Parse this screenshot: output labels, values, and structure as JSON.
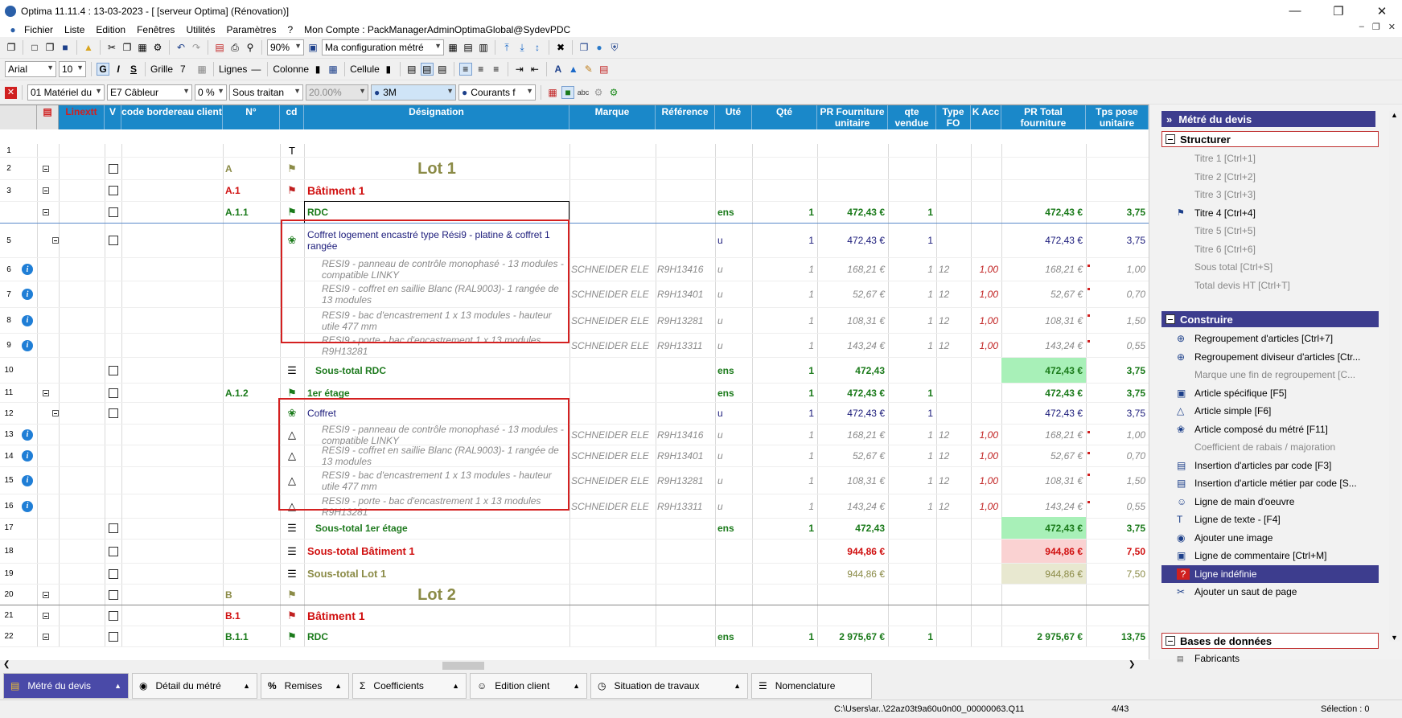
{
  "window": {
    "title": "Optima 11.11.4 : 13-03-2023 - [ [serveur Optima] (Rénovation)]"
  },
  "menu": [
    "Fichier",
    "Liste",
    "Edition",
    "Fenêtres",
    "Utilités",
    "Paramètres",
    "?",
    "Mon Compte : PackManagerAdminOptimaGlobal@SydevPDC"
  ],
  "toolbar1": {
    "zoom": "90%",
    "config": "Ma configuration métré"
  },
  "toolbar2": {
    "font": "Arial",
    "size": "10",
    "bold": "G",
    "italic": "I",
    "strike": "S",
    "grille": "Grille",
    "grille_val": "7",
    "lignes": "Lignes",
    "colonne": "Colonne",
    "cellule": "Cellule"
  },
  "toolbar3": {
    "materiel": "01  Matériel du",
    "cableur": "E7  Câbleur",
    "pct": "0 %",
    "sous_traitance": "Sous traitan",
    "taux": "20.00%",
    "fabricant": "3M",
    "courants": "Courants f"
  },
  "columns": {
    "linextt": "Linextt",
    "v": "V",
    "code": "code bordereau client",
    "n": "N°",
    "cd": "cd",
    "designation": "Désignation",
    "marque": "Marque",
    "reference": "Référence",
    "ute": "Uté",
    "qte": "Qté",
    "pr_fourn": "PR Fourniture unitaire",
    "qte_vendue": "qte vendue",
    "type_fo": "Type FO",
    "k_acc": "K Acc",
    "pr_total": "PR Total fourniture",
    "tps_pose": "Tps pose unitaire"
  },
  "rows": [
    {
      "n": "1",
      "code": "",
      "des": "",
      "ute": "",
      "qte": "",
      "pu": "",
      "qv": "",
      "fo": "",
      "k": "",
      "tot": "",
      "tps": ""
    },
    {
      "n": "2",
      "code": "A",
      "des": "Lot 1",
      "ute": "",
      "qte": "",
      "pu": "",
      "qv": "",
      "fo": "",
      "k": "",
      "tot": "",
      "tps": ""
    },
    {
      "n": "3",
      "code": "A.1",
      "des": "Bâtiment 1",
      "ute": "",
      "qte": "",
      "pu": "",
      "qv": "",
      "fo": "",
      "k": "",
      "tot": "",
      "tps": ""
    },
    {
      "n": "",
      "code": "A.1.1",
      "des": "RDC",
      "ute": "ens",
      "qte": "1",
      "pu": "472,43 €",
      "qv": "1",
      "fo": "",
      "k": "",
      "tot": "472,43 €",
      "tps": "3,75"
    },
    {
      "n": "5",
      "code": "",
      "des": "Coffret logement encastré type Rési9 - platine & coffret 1 rangée",
      "ute": "u",
      "qte": "1",
      "pu": "472,43 €",
      "qv": "1",
      "fo": "",
      "k": "",
      "tot": "472,43 €",
      "tps": "3,75"
    },
    {
      "n": "6",
      "code": "",
      "des": "RESI9 - panneau de contrôle monophasé - 13 modules - compatible LINKY",
      "marque": "SCHNEIDER ELE",
      "ref": "R9H13416",
      "ute": "u",
      "qte": "1",
      "pu": "168,21 €",
      "qv": "1",
      "fo": "12",
      "k": "1,00",
      "tot": "168,21 €",
      "tps": "1,00"
    },
    {
      "n": "7",
      "code": "",
      "des": "RESI9 - coffret en saillie Blanc (RAL9003)- 1 rangée de 13 modules",
      "marque": "SCHNEIDER ELE",
      "ref": "R9H13401",
      "ute": "u",
      "qte": "1",
      "pu": "52,67 €",
      "qv": "1",
      "fo": "12",
      "k": "1,00",
      "tot": "52,67 €",
      "tps": "0,70"
    },
    {
      "n": "8",
      "code": "",
      "des": "RESI9 - bac d'encastrement 1 x 13 modules - hauteur utile 477 mm",
      "marque": "SCHNEIDER ELE",
      "ref": "R9H13281",
      "ute": "u",
      "qte": "1",
      "pu": "108,31 €",
      "qv": "1",
      "fo": "12",
      "k": "1,00",
      "tot": "108,31 €",
      "tps": "1,50"
    },
    {
      "n": "9",
      "code": "",
      "des": "RESI9 - porte - bac d'encastrement 1 x 13 modules R9H13281",
      "marque": "SCHNEIDER ELE",
      "ref": "R9H13311",
      "ute": "u",
      "qte": "1",
      "pu": "143,24 €",
      "qv": "1",
      "fo": "12",
      "k": "1,00",
      "tot": "143,24 €",
      "tps": "0,55"
    },
    {
      "n": "10",
      "code": "",
      "des": "Sous-total RDC",
      "ute": "ens",
      "qte": "1",
      "pu": "472,43",
      "qv": "",
      "fo": "",
      "k": "",
      "tot": "472,43 €",
      "tps": "3,75"
    },
    {
      "n": "11",
      "code": "A.1.2",
      "des": "1er étage",
      "ute": "ens",
      "qte": "1",
      "pu": "472,43 €",
      "qv": "1",
      "fo": "",
      "k": "",
      "tot": "472,43 €",
      "tps": "3,75"
    },
    {
      "n": "12",
      "code": "",
      "des": "Coffret",
      "ute": "u",
      "qte": "1",
      "pu": "472,43 €",
      "qv": "1",
      "fo": "",
      "k": "",
      "tot": "472,43 €",
      "tps": "3,75"
    },
    {
      "n": "13",
      "code": "",
      "des": "RESI9 - panneau de contrôle monophasé - 13 modules - compatible LINKY",
      "marque": "SCHNEIDER ELE",
      "ref": "R9H13416",
      "ute": "u",
      "qte": "1",
      "pu": "168,21 €",
      "qv": "1",
      "fo": "12",
      "k": "1,00",
      "tot": "168,21 €",
      "tps": "1,00"
    },
    {
      "n": "14",
      "code": "",
      "des": "RESI9 - coffret en saillie Blanc (RAL9003)- 1 rangée de 13 modules",
      "marque": "SCHNEIDER ELE",
      "ref": "R9H13401",
      "ute": "u",
      "qte": "1",
      "pu": "52,67 €",
      "qv": "1",
      "fo": "12",
      "k": "1,00",
      "tot": "52,67 €",
      "tps": "0,70"
    },
    {
      "n": "15",
      "code": "",
      "des": "RESI9 - bac d'encastrement 1 x 13 modules - hauteur utile 477 mm",
      "marque": "SCHNEIDER ELE",
      "ref": "R9H13281",
      "ute": "u",
      "qte": "1",
      "pu": "108,31 €",
      "qv": "1",
      "fo": "12",
      "k": "1,00",
      "tot": "108,31 €",
      "tps": "1,50"
    },
    {
      "n": "16",
      "code": "",
      "des": "RESI9 - porte - bac d'encastrement 1 x 13 modules R9H13281",
      "marque": "SCHNEIDER ELE",
      "ref": "R9H13311",
      "ute": "u",
      "qte": "1",
      "pu": "143,24 €",
      "qv": "1",
      "fo": "12",
      "k": "1,00",
      "tot": "143,24 €",
      "tps": "0,55"
    },
    {
      "n": "17",
      "code": "",
      "des": "Sous-total 1er étage",
      "ute": "ens",
      "qte": "1",
      "pu": "472,43",
      "qv": "",
      "fo": "",
      "k": "",
      "tot": "472,43 €",
      "tps": "3,75"
    },
    {
      "n": "18",
      "code": "",
      "des": "Sous-total Bâtiment 1",
      "ute": "",
      "qte": "",
      "pu": "944,86 €",
      "qv": "",
      "fo": "",
      "k": "",
      "tot": "944,86 €",
      "tps": "7,50"
    },
    {
      "n": "19",
      "code": "",
      "des": "Sous-total Lot 1",
      "ute": "",
      "qte": "",
      "pu": "944,86 €",
      "qv": "",
      "fo": "",
      "k": "",
      "tot": "944,86 €",
      "tps": "7,50"
    },
    {
      "n": "20",
      "code": "B",
      "des": "Lot 2",
      "ute": "",
      "qte": "",
      "pu": "",
      "qv": "",
      "fo": "",
      "k": "",
      "tot": "",
      "tps": ""
    },
    {
      "n": "21",
      "code": "B.1",
      "des": "Bâtiment 1",
      "ute": "",
      "qte": "",
      "pu": "",
      "qv": "",
      "fo": "",
      "k": "",
      "tot": "",
      "tps": ""
    },
    {
      "n": "22",
      "code": "B.1.1",
      "des": "RDC",
      "ute": "ens",
      "qte": "1",
      "pu": "2 975,67 €",
      "qv": "1",
      "fo": "",
      "k": "",
      "tot": "2 975,67 €",
      "tps": "13,75"
    }
  ],
  "panel": {
    "title": "Métré du devis",
    "structurer": "Structurer",
    "structurer_items": [
      "Titre 1 [Ctrl+1]",
      "Titre 2 [Ctrl+2]",
      "Titre 3 [Ctrl+3]",
      "Titre 4 [Ctrl+4]",
      "Titre 5 [Ctrl+5]",
      "Titre 6 [Ctrl+6]",
      "Sous total [Ctrl+S]",
      "Total devis HT [Ctrl+T]"
    ],
    "construire": "Construire",
    "construire_items": [
      "Regroupement d'articles  [Ctrl+7]",
      "Regroupement diviseur d'articles [Ctr...",
      "Marque une fin de regroupement  [C...",
      "Article spécifique [F5]",
      "Article simple [F6]",
      "Article composé du métré [F11]",
      "Coefficient de rabais / majoration",
      "Insertion d'articles par code [F3]",
      "Insertion d'article métier par code [S...",
      "Ligne de main d'oeuvre",
      "Ligne de texte - [F4]",
      "Ajouter une image",
      "Ligne de commentaire [Ctrl+M]",
      "Ligne indéfinie",
      "Ajouter un saut de page"
    ],
    "bases": "Bases de données",
    "bases_items": [
      "Fabricants"
    ]
  },
  "tabs": [
    "Métré du devis",
    "Détail du métré",
    "Remises",
    "Coefficients",
    "Edition client",
    "Situation de travaux",
    "Nomenclature"
  ],
  "status": {
    "path": "C:\\Users\\ar..\\22az03t9a60u0n00_00000063.Q11",
    "pos": "4/43",
    "selection": "Sélection : 0"
  }
}
